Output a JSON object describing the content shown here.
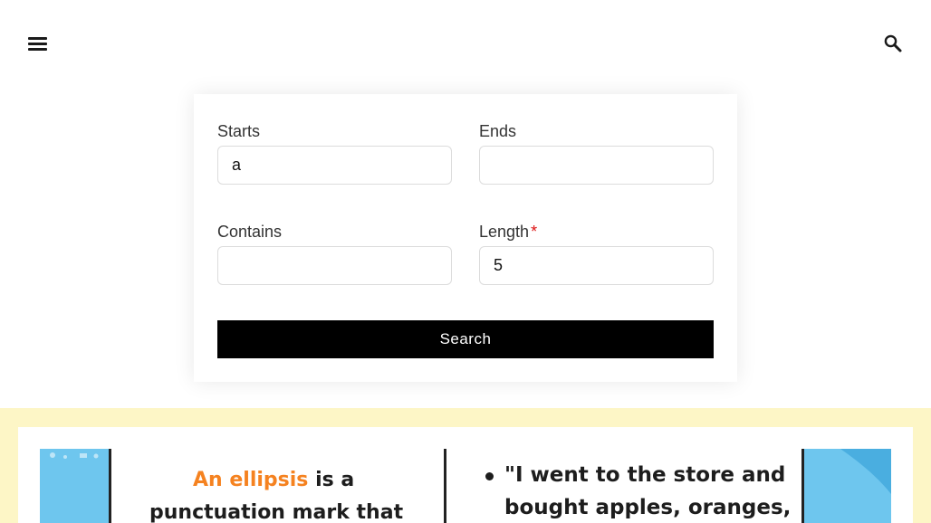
{
  "header": {
    "menu_icon": "hamburger-menu-icon",
    "search_icon": "search-icon"
  },
  "form": {
    "starts": {
      "label": "Starts",
      "value": "a",
      "placeholder": ""
    },
    "ends": {
      "label": "Ends",
      "value": "",
      "placeholder": ""
    },
    "contains": {
      "label": "Contains",
      "value": "",
      "placeholder": ""
    },
    "length": {
      "label": "Length",
      "required_mark": "*",
      "value": "5",
      "placeholder": ""
    },
    "submit_label": "Search"
  },
  "colors": {
    "band": "#fdf6c6",
    "button": "#000000",
    "required": "#dd1111",
    "accent_orange": "#f58220",
    "infographic_blue": "#6ec6ee"
  },
  "infographic": {
    "left": {
      "line1_highlight_a": "An",
      "line1_highlight_b": "ellipsis",
      "line1_rest": "is a",
      "line2": "punctuation mark that"
    },
    "right": {
      "line1": "\"I went to the store and",
      "line2": "bought apples, oranges,"
    }
  }
}
